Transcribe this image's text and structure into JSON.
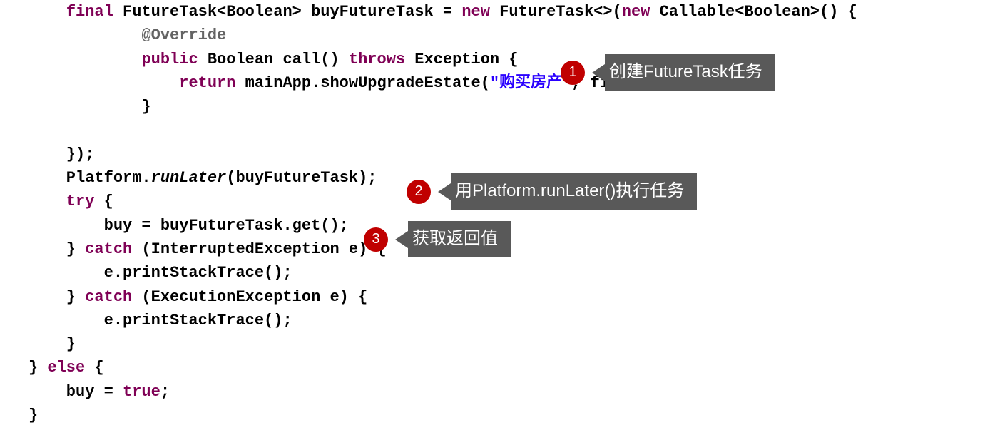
{
  "code": {
    "l1": {
      "a": "final",
      "b": " FutureTask<Boolean> buyFutureTask = ",
      "c": "new",
      "d": " FutureTask<>(",
      "e": "new",
      "f": " Callable<Boolean>() {"
    },
    "l2": {
      "a": "@Override"
    },
    "l3": {
      "a": "public",
      "b": " Boolean call() ",
      "c": "throws",
      "d": " Exception {"
    },
    "l4": {
      "a": "return",
      "b": " mainApp.showUpgradeEstate(",
      "c": "\"购买房产\"",
      "d": ", finalMessage);"
    },
    "l5": "            }",
    "l6": "",
    "l7": "    });",
    "l8": {
      "a": "    Platform.",
      "b": "runLater",
      "c": "(buyFutureTask);"
    },
    "l9": {
      "a": "try",
      "b": " {"
    },
    "l10": "        buy = buyFutureTask.get();",
    "l11": {
      "a": "    } ",
      "b": "catch",
      "c": " (InterruptedException e) {"
    },
    "l12": "        e.printStackTrace();",
    "l13": {
      "a": "    } ",
      "b": "catch",
      "c": " (ExecutionException e) {"
    },
    "l14": "        e.printStackTrace();",
    "l15": "    }",
    "l16": {
      "a": "} ",
      "b": "else",
      "c": " {"
    },
    "l17": {
      "a": "    buy = ",
      "b": "true",
      "c": ";"
    },
    "l18": "}"
  },
  "callouts": {
    "c1": {
      "num": "1",
      "text": "创建FutureTask任务"
    },
    "c2": {
      "num": "2",
      "text": "用Platform.runLater()执行任务"
    },
    "c3": {
      "num": "3",
      "text": "获取返回值"
    }
  }
}
